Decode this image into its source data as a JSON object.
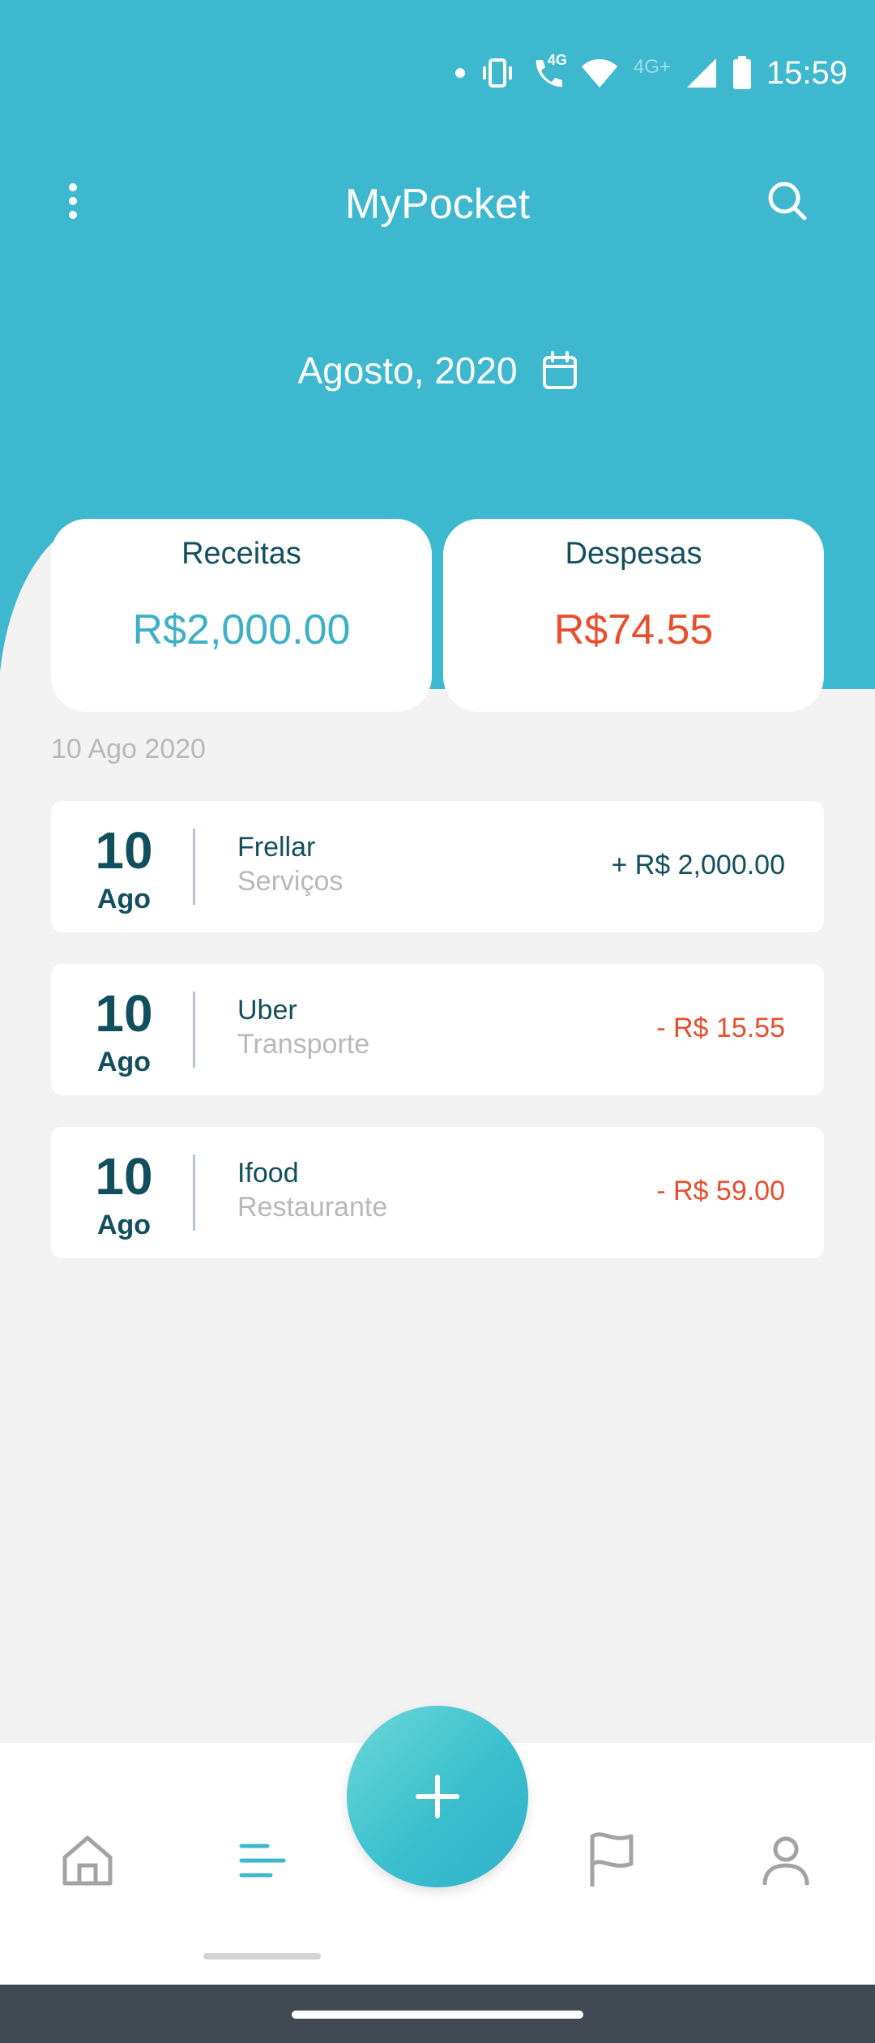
{
  "status_bar": {
    "time": "15:59",
    "net_label_1": "4G",
    "net_label_2": "4G+"
  },
  "header": {
    "title": "MyPocket",
    "month": "Agosto, 2020"
  },
  "summary": {
    "income_label": "Receitas",
    "income_value": "R$2,000.00",
    "expense_label": "Despesas",
    "expense_value": "R$74.55"
  },
  "date_header": "10 Ago 2020",
  "transactions": [
    {
      "day": "10",
      "month": "Ago",
      "name": "Frellar",
      "category": "Serviços",
      "amount": "+ R$ 2,000.00",
      "type": "income"
    },
    {
      "day": "10",
      "month": "Ago",
      "name": "Uber",
      "category": "Transporte",
      "amount": "- R$ 15.55",
      "type": "expense"
    },
    {
      "day": "10",
      "month": "Ago",
      "name": "Ifood",
      "category": "Restaurante",
      "amount": "- R$ 59.00",
      "type": "expense"
    }
  ],
  "colors": {
    "header": "#3db8cf",
    "dark_text": "#124f5e",
    "expense": "#e84e2c",
    "income": "#3db0c8"
  },
  "nav": {
    "items": [
      "home-icon",
      "list-icon",
      "add-icon",
      "flag-icon",
      "profile-icon"
    ],
    "active": "list-icon"
  }
}
